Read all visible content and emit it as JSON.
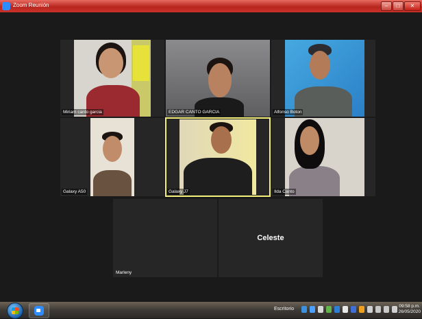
{
  "window": {
    "title": "Zoom Reunión"
  },
  "participants": [
    {
      "name": "Miriam canto garcia",
      "active": false
    },
    {
      "name": "EDGAR CANTO GARCIA",
      "active": false
    },
    {
      "name": "Alfonso Boton",
      "active": false
    },
    {
      "name": "Galaxy A50",
      "active": false
    },
    {
      "name": "Galaxy J7",
      "active": true
    },
    {
      "name": "Ilda Canto",
      "active": false
    },
    {
      "name": "Marleny",
      "active": false
    },
    {
      "name": "",
      "display_text": "Celeste",
      "active": false
    }
  ],
  "taskbar": {
    "desktop_label": "Escritorio",
    "clock_time": "09:58 p.m.",
    "clock_date": "26/05/2020"
  },
  "colors": {
    "active_speaker": "#f4f07a",
    "titlebar": "#c9322a"
  }
}
